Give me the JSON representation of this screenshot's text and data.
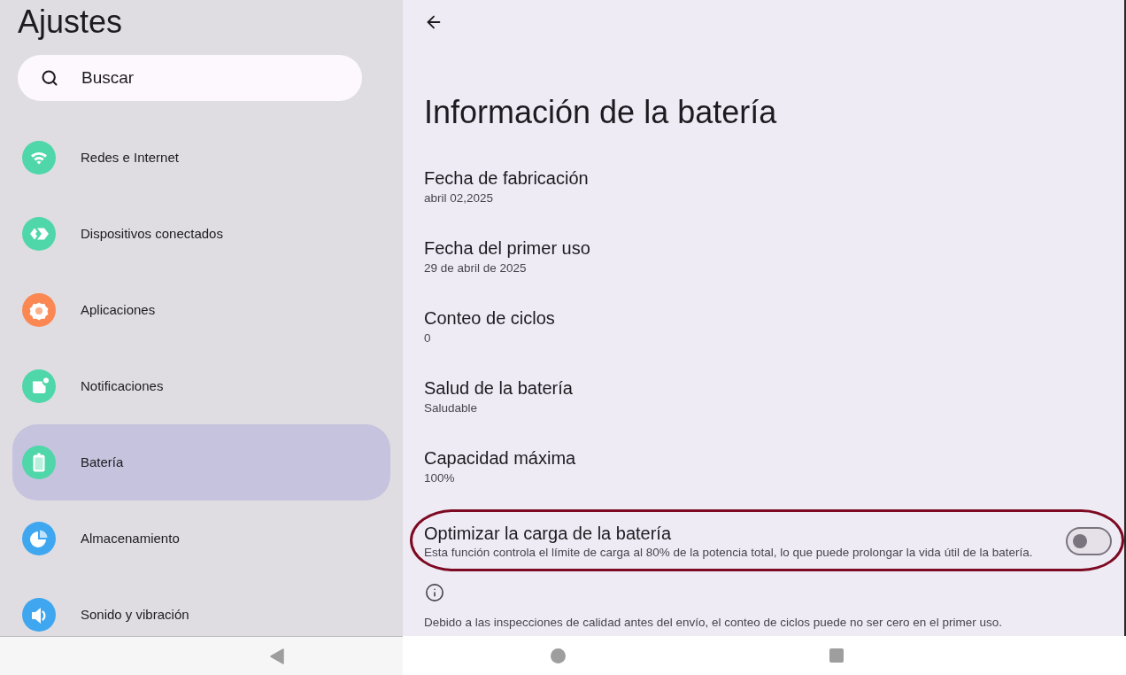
{
  "sidebar": {
    "title": "Ajustes",
    "search": {
      "placeholder": "Buscar"
    },
    "items": [
      {
        "label": "Redes e Internet",
        "color": "#4fd6a9",
        "selected": false
      },
      {
        "label": "Dispositivos conectados",
        "color": "#4fd6a9",
        "selected": false
      },
      {
        "label": "Aplicaciones",
        "color": "#fb8753",
        "selected": false
      },
      {
        "label": "Notificaciones",
        "color": "#4fd6a9",
        "selected": false
      },
      {
        "label": "Batería",
        "color": "#4fd6a9",
        "selected": true
      },
      {
        "label": "Almacenamiento",
        "color": "#3fa6f0",
        "selected": false
      },
      {
        "label": "Sonido y vibración",
        "color": "#3fa6f0",
        "selected": false
      }
    ]
  },
  "page": {
    "title": "Información de la batería",
    "details": [
      {
        "title": "Fecha de fabricación",
        "value": "abril 02,2025"
      },
      {
        "title": "Fecha del primer uso",
        "value": "29 de abril de 2025"
      },
      {
        "title": "Conteo de ciclos",
        "value": "0"
      },
      {
        "title": "Salud de la batería",
        "value": "Saludable"
      },
      {
        "title": "Capacidad máxima",
        "value": "100%"
      }
    ],
    "optimize_charging": {
      "title": "Optimizar la carga de la batería",
      "description": "Esta función controla el límite de carga al 80% de la potencia total, lo que puede prolongar la vida útil de la batería.",
      "on": false,
      "highlighted": true
    },
    "footer_note": "Debido a las inspecciones de calidad antes del envío, el conteo de ciclos puede no ser cero en el primer uso."
  }
}
